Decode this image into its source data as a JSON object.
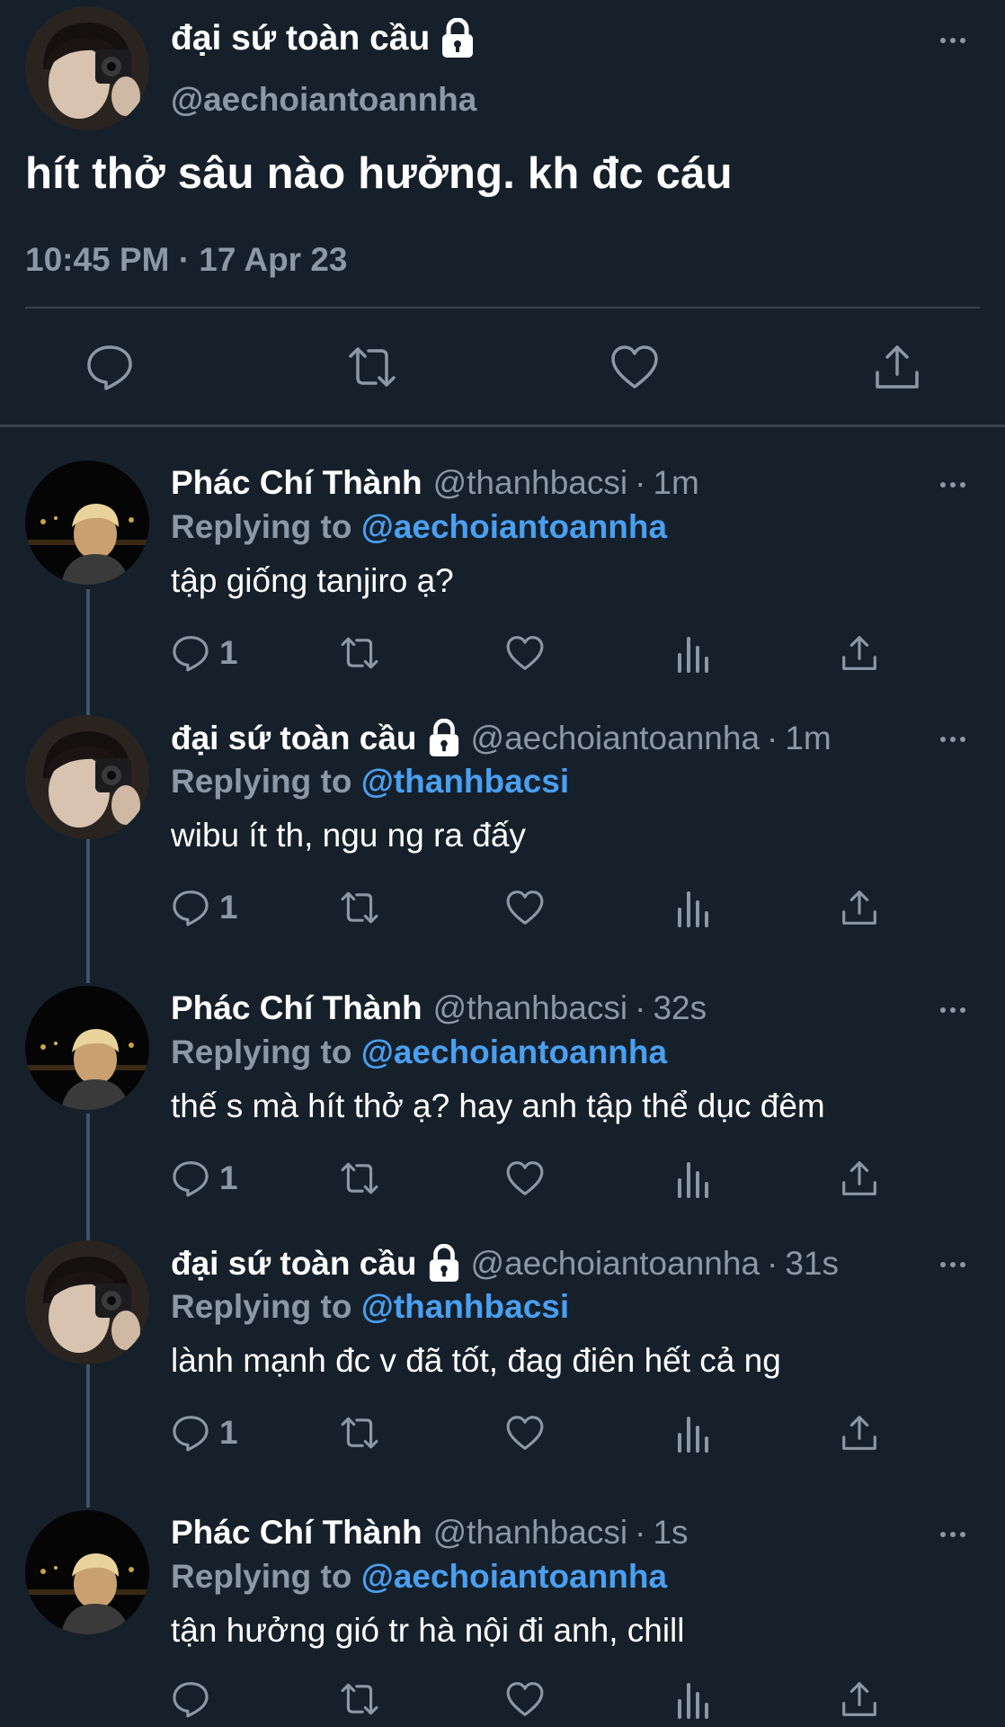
{
  "main_tweet": {
    "display_name": "đại sứ toàn cầu",
    "handle": "@aechoiantoannha",
    "text": "hít thở sâu nào hưởng. kh đc cáu",
    "timestamp": "10:45 PM · 17 Apr 23",
    "protected_icon": "lock-icon",
    "actions": [
      "reply-icon",
      "retweet-icon",
      "like-icon",
      "share-icon"
    ]
  },
  "replies": [
    {
      "display_name": "Phác Chí Thành",
      "handle": "@thanhbacsi",
      "separator": "·",
      "time": "1m",
      "replying_label": "Replying to",
      "replying_to": "@aechoiantoannha",
      "text": "tập giống tanjiro ạ?",
      "reply_count": "1",
      "protected": false
    },
    {
      "display_name": "đại sứ toàn cầu",
      "handle": "@aechoiantoannha",
      "separator": "·",
      "time": "1m",
      "replying_label": "Replying to",
      "replying_to": "@thanhbacsi",
      "text": "wibu ít th, ngu ng ra đấy",
      "reply_count": "1",
      "protected": true
    },
    {
      "display_name": "Phác Chí Thành",
      "handle": "@thanhbacsi",
      "separator": "·",
      "time": "32s",
      "replying_label": "Replying to",
      "replying_to": "@aechoiantoannha",
      "text": "thế s mà hít thở ạ? hay anh tập thể dục đêm",
      "reply_count": "1",
      "protected": false
    },
    {
      "display_name": "đại sứ toàn cầu",
      "handle": "@aechoiantoannha",
      "separator": "·",
      "time": "31s",
      "replying_label": "Replying to",
      "replying_to": "@thanhbacsi",
      "text": "lành mạnh đc v đã tốt, đag điên hết cả ng",
      "reply_count": "1",
      "protected": true
    },
    {
      "display_name": "Phác Chí Thành",
      "handle": "@thanhbacsi",
      "separator": "·",
      "time": "1s",
      "replying_label": "Replying to",
      "replying_to": "@aechoiantoannha",
      "text": "tận hưởng gió tr hà nội đi anh, chill",
      "reply_count": "",
      "protected": false
    }
  ],
  "colors": {
    "background": "#15202b",
    "secondary_text": "#8b98a5",
    "link": "#4a9ff0",
    "divider": "#38444d"
  }
}
